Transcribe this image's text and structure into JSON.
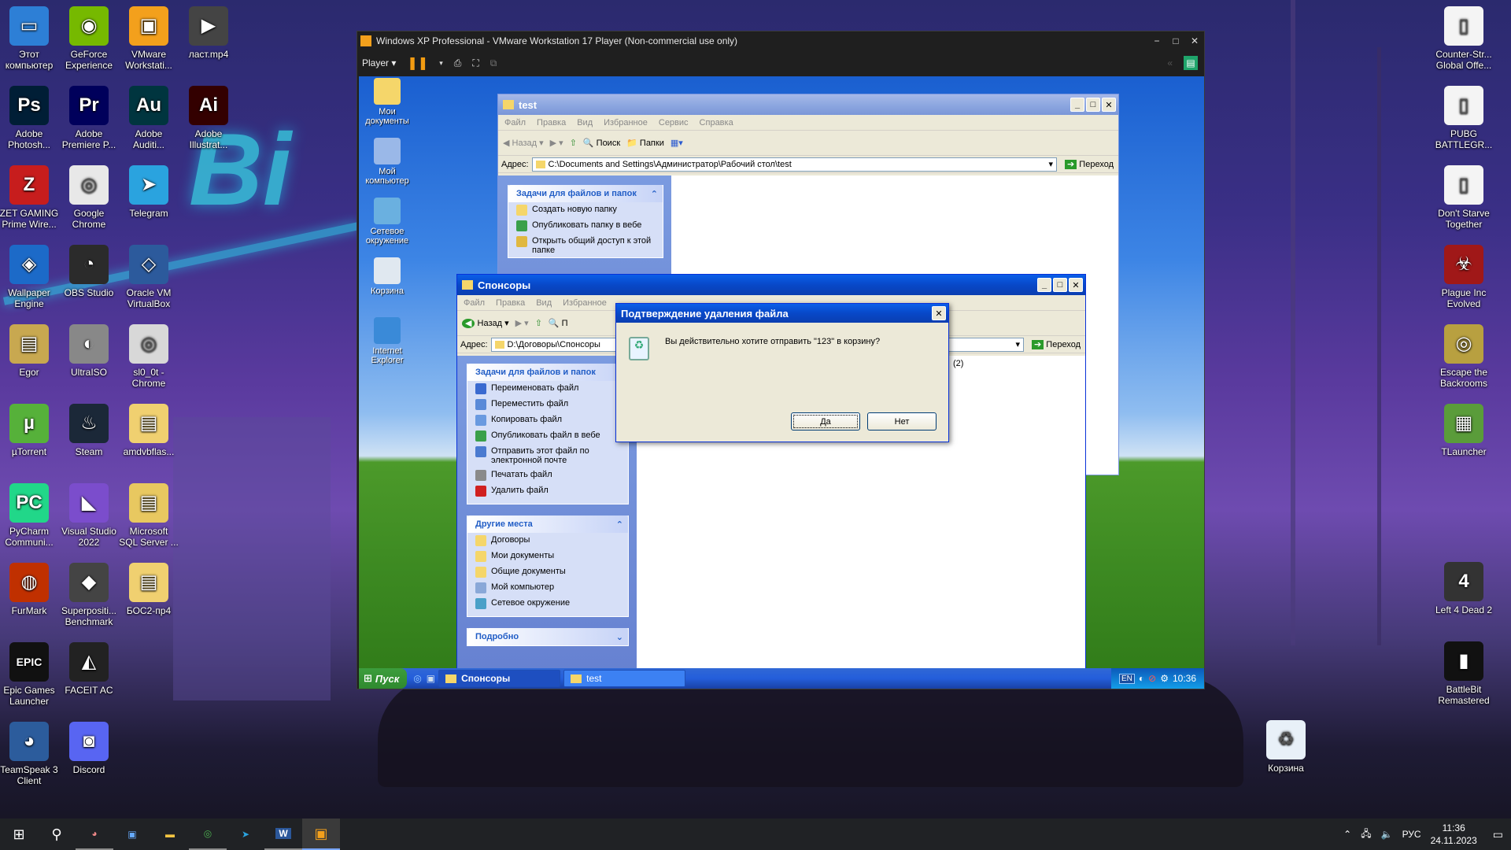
{
  "desktop_left": [
    {
      "label": "Этот компьютер",
      "icon": "this-pc-icon",
      "color": "#2d7fd6",
      "glyph": "▭"
    },
    {
      "label": "GeForce Experience",
      "icon": "geforce-icon",
      "color": "#76b900",
      "glyph": "◉"
    },
    {
      "label": "VMware Workstati...",
      "icon": "vmware-icon",
      "color": "#f3a01c",
      "glyph": "▣"
    },
    {
      "label": "ласт.mp4",
      "icon": "video-file-icon",
      "color": "#444",
      "glyph": "▶"
    },
    {
      "label": "Adobe Photosh...",
      "icon": "photoshop-icon",
      "color": "#001e36",
      "glyph": "Ps"
    },
    {
      "label": "Adobe Premiere P...",
      "icon": "premiere-icon",
      "color": "#00005b",
      "glyph": "Pr"
    },
    {
      "label": "Adobe Auditi...",
      "icon": "audition-icon",
      "color": "#00353f",
      "glyph": "Au"
    },
    {
      "label": "Adobe Illustrat...",
      "icon": "illustrator-icon",
      "color": "#330000",
      "glyph": "Ai"
    },
    {
      "label": "ZET GAMING Prime Wire...",
      "icon": "zet-gaming-icon",
      "color": "#c71d1d",
      "glyph": "Z"
    },
    {
      "label": "Google Chrome",
      "icon": "chrome-icon",
      "color": "#e8e8e8",
      "glyph": "◎"
    },
    {
      "label": "Telegram",
      "icon": "telegram-icon",
      "color": "#2aa3df",
      "glyph": "➤"
    },
    {
      "label": "Wallpaper Engine",
      "icon": "wallpaper-engine-icon",
      "color": "#1c6ac8",
      "glyph": "◈"
    },
    {
      "label": "OBS Studio",
      "icon": "obs-icon",
      "color": "#2b2b2b",
      "glyph": "◔"
    },
    {
      "label": "Oracle VM VirtualBox",
      "icon": "virtualbox-icon",
      "color": "#2c5a9c",
      "glyph": "◇"
    },
    {
      "label": "Egor",
      "icon": "folder-egor-icon",
      "color": "#c8a850",
      "glyph": "▤"
    },
    {
      "label": "UltraISO",
      "icon": "ultraiso-icon",
      "color": "#888",
      "glyph": "◐"
    },
    {
      "label": "sl0_0t - Chrome",
      "icon": "chrome-profile-icon",
      "color": "#d8d8d8",
      "glyph": "◎"
    },
    {
      "label": "µTorrent",
      "icon": "utorrent-icon",
      "color": "#56b13a",
      "glyph": "µ"
    },
    {
      "label": "Steam",
      "icon": "steam-icon",
      "color": "#1b2838",
      "glyph": "♨"
    },
    {
      "label": "amdvbflas...",
      "icon": "folder-amd-icon",
      "color": "#f0d070",
      "glyph": "▤"
    },
    {
      "label": "PyCharm Communi...",
      "icon": "pycharm-icon",
      "color": "#21d789",
      "glyph": "PC"
    },
    {
      "label": "Visual Studio 2022",
      "icon": "visual-studio-icon",
      "color": "#7b4dcc",
      "glyph": "◣"
    },
    {
      "label": "Microsoft SQL Server ...",
      "icon": "sql-server-icon",
      "color": "#e8c860",
      "glyph": "▤"
    },
    {
      "label": "FurMark",
      "icon": "furmark-icon",
      "color": "#c03000",
      "glyph": "◍"
    },
    {
      "label": "Superpositi... Benchmark",
      "icon": "superposition-icon",
      "color": "#444",
      "glyph": "◆"
    },
    {
      "label": "БОС2-пр4",
      "icon": "folder-bos-icon",
      "color": "#f0d070",
      "glyph": "▤"
    },
    {
      "label": "Epic Games Launcher",
      "icon": "epic-games-icon",
      "color": "#111",
      "glyph": "EPIC"
    },
    {
      "label": "FACEIT AC",
      "icon": "faceit-icon",
      "color": "#222",
      "glyph": "◭"
    },
    {
      "label": "TeamSpeak 3 Client",
      "icon": "teamspeak-icon",
      "color": "#2c5c9c",
      "glyph": "◕"
    },
    {
      "label": "Discord",
      "icon": "discord-icon",
      "color": "#5865f2",
      "glyph": "◙"
    }
  ],
  "desktop_right": [
    {
      "label": "Counter-Str... Global Offe...",
      "icon": "csgo-file-icon",
      "color": "#f4f4f4",
      "glyph": "▯"
    },
    {
      "label": "PUBG BATTLEGR...",
      "icon": "pubg-file-icon",
      "color": "#f4f4f4",
      "glyph": "▯"
    },
    {
      "label": "Don't Starve Together",
      "icon": "dst-file-icon",
      "color": "#f4f4f4",
      "glyph": "▯"
    },
    {
      "label": "Plague Inc Evolved",
      "icon": "plague-inc-icon",
      "color": "#a01818",
      "glyph": "☣"
    },
    {
      "label": "Escape the Backrooms",
      "icon": "backrooms-icon",
      "color": "#b8a040",
      "glyph": "◎"
    },
    {
      "label": "TLauncher",
      "icon": "tlauncher-icon",
      "color": "#5a9c3a",
      "glyph": "▦"
    },
    {
      "label": "Left 4 Dead 2",
      "icon": "l4d2-icon",
      "color": "#333",
      "glyph": "4"
    },
    {
      "label": "BattleBit Remastered",
      "icon": "battlebit-icon",
      "color": "#111",
      "glyph": "▮"
    },
    {
      "label": "Корзина",
      "icon": "recycle-bin-icon",
      "color": "#e8f0f8",
      "glyph": "♻"
    }
  ],
  "vmware": {
    "title": "Windows XP Professional - VMware Workstation 17 Player (Non-commercial use only)",
    "player_label": "Player",
    "controls": [
      "−",
      "□",
      "✕"
    ]
  },
  "xp_desktop": [
    {
      "label": "Мои документы",
      "icon": "my-documents-icon"
    },
    {
      "label": "Мой компьютер",
      "icon": "my-computer-icon"
    },
    {
      "label": "Сетевое окружение",
      "icon": "network-icon"
    },
    {
      "label": "Корзина",
      "icon": "xp-recycle-bin-icon"
    },
    {
      "label": "Internet Explorer",
      "icon": "ie-icon"
    }
  ],
  "win_test": {
    "title": "test",
    "menu": [
      "Файл",
      "Правка",
      "Вид",
      "Избранное",
      "Сервис",
      "Справка"
    ],
    "back": "Назад",
    "search": "Поиск",
    "folders": "Папки",
    "address_label": "Адрес:",
    "address": "C:\\Documents and Settings\\Администратор\\Рабочий стол\\test",
    "go": "Переход",
    "tasks_title": "Задачи для файлов и папок",
    "tasks": [
      "Создать новую папку",
      "Опубликовать папку в вебе",
      "Открыть общий доступ к этой папке"
    ]
  },
  "win_sponsors": {
    "title": "Спонсоры",
    "menu": [
      "Файл",
      "Правка",
      "Вид",
      "Избранное"
    ],
    "back": "Назад",
    "search_partial": "П",
    "address_label": "Адрес:",
    "address": "D:\\Договоры\\Спонсоры",
    "go": "Переход",
    "tasks_title": "Задачи для файлов и папок",
    "tasks": [
      "Переименовать файл",
      "Переместить файл",
      "Копировать файл",
      "Опубликовать файл в вебе",
      "Отправить этот файл по электронной почте",
      "Печатать файл",
      "Удалить файл"
    ],
    "places_title": "Другие места",
    "places": [
      "Договоры",
      "Мои документы",
      "Общие документы",
      "Мой компьютер",
      "Сетевое окружение"
    ],
    "details_partial": "Подробно",
    "file_fragment": "(2)"
  },
  "dialog": {
    "title": "Подтверждение удаления файла",
    "message": "Вы действительно хотите отправить \"123\" в корзину?",
    "yes": "Да",
    "no": "Нет"
  },
  "xp_taskbar": {
    "start": "Пуск",
    "buttons": [
      {
        "label": "Спонсоры",
        "active": true
      },
      {
        "label": "test",
        "active": false
      }
    ],
    "lang": "EN",
    "time": "10:36"
  },
  "taskbar": {
    "lang": "РУС",
    "time": "11:36",
    "date": "24.11.2023"
  }
}
